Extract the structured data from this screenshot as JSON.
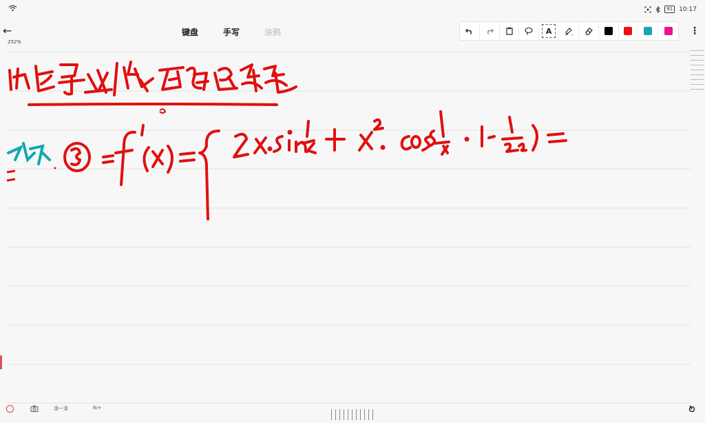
{
  "status_bar": {
    "time": "10:17",
    "battery": "91",
    "wifi_icon": "wifi-icon",
    "screenshot_icon": "screenshot-icon",
    "bluetooth_icon": "bluetooth-icon"
  },
  "header": {
    "back_icon": "arrow-left-icon",
    "zoom_level": "252%",
    "tabs": [
      {
        "label": "键盘",
        "state": "active"
      },
      {
        "label": "手写",
        "state": "active"
      },
      {
        "label": "涂鸦",
        "state": "disabled"
      }
    ]
  },
  "toolbar": {
    "undo_icon": "undo-icon",
    "redo_icon": "redo-icon",
    "paste_icon": "clipboard-icon",
    "lasso_icon": "lasso-icon",
    "text_tool_label": "A",
    "highlighter_icon": "highlighter-icon",
    "eraser_icon": "eraser-icon",
    "colors": [
      "#000000",
      "#ee1111",
      "#14a8b4",
      "#ee1188"
    ],
    "more_icon": "more-vertical-icon"
  },
  "canvas": {
    "ink_colors": {
      "red": "#e01010",
      "teal": "#12a8b0"
    }
  },
  "bottom_bar": {
    "record_icon": "record-icon",
    "camera_icon": "camera-icon",
    "label_1": "涂一涂",
    "label_2": "8/+",
    "page_slider_icon": "page-slider-icon",
    "pen_icon": "pen-icon"
  }
}
